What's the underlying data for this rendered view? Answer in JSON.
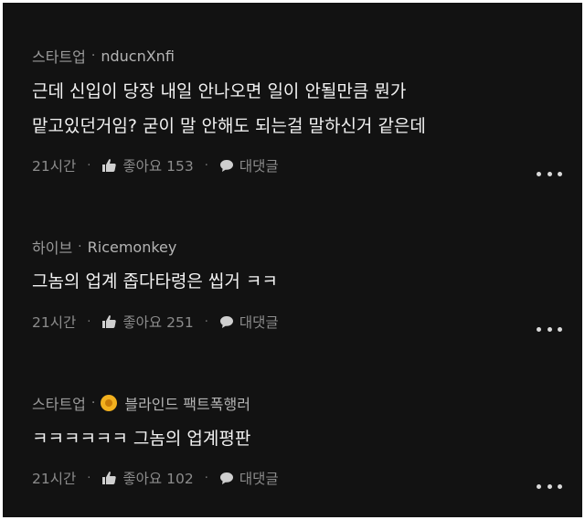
{
  "comments": [
    {
      "company": "스타트업",
      "nickname": "nducnXnfi",
      "lines": [
        "근데 신입이 당장 내일 안나오면 일이 안될만큼 뭔가",
        "맡고있던거임? 굳이 말 안해도 되는걸 말하신거 같은데"
      ],
      "time": "21시간",
      "like_label": "좋아요 153",
      "reply_label": "대댓글"
    },
    {
      "company": "하이브",
      "nickname": "Ricemonkey",
      "lines": [
        "그놈의 업계 좁다타령은 씹거 ㅋㅋ"
      ],
      "time": "21시간",
      "like_label": "좋아요 251",
      "reply_label": "대댓글"
    },
    {
      "company": "스타트업",
      "nickname": "블라인드 팩트폭행러",
      "lines": [
        "ㅋㅋㅋㅋㅋㅋ 그놈의 업계평판"
      ],
      "time": "21시간",
      "like_label": "좋아요 102",
      "reply_label": "대댓글"
    }
  ],
  "separator": "·",
  "icons": {
    "like": "thumbs-up-icon",
    "reply": "speech-bubble-icon",
    "more": "more-horizontal-icon",
    "badge": "gold-badge-icon"
  },
  "colors": {
    "background": "#121212",
    "text": "#f2f2f2",
    "meta": "#8c8c8c",
    "badge": "#f2b01e"
  }
}
